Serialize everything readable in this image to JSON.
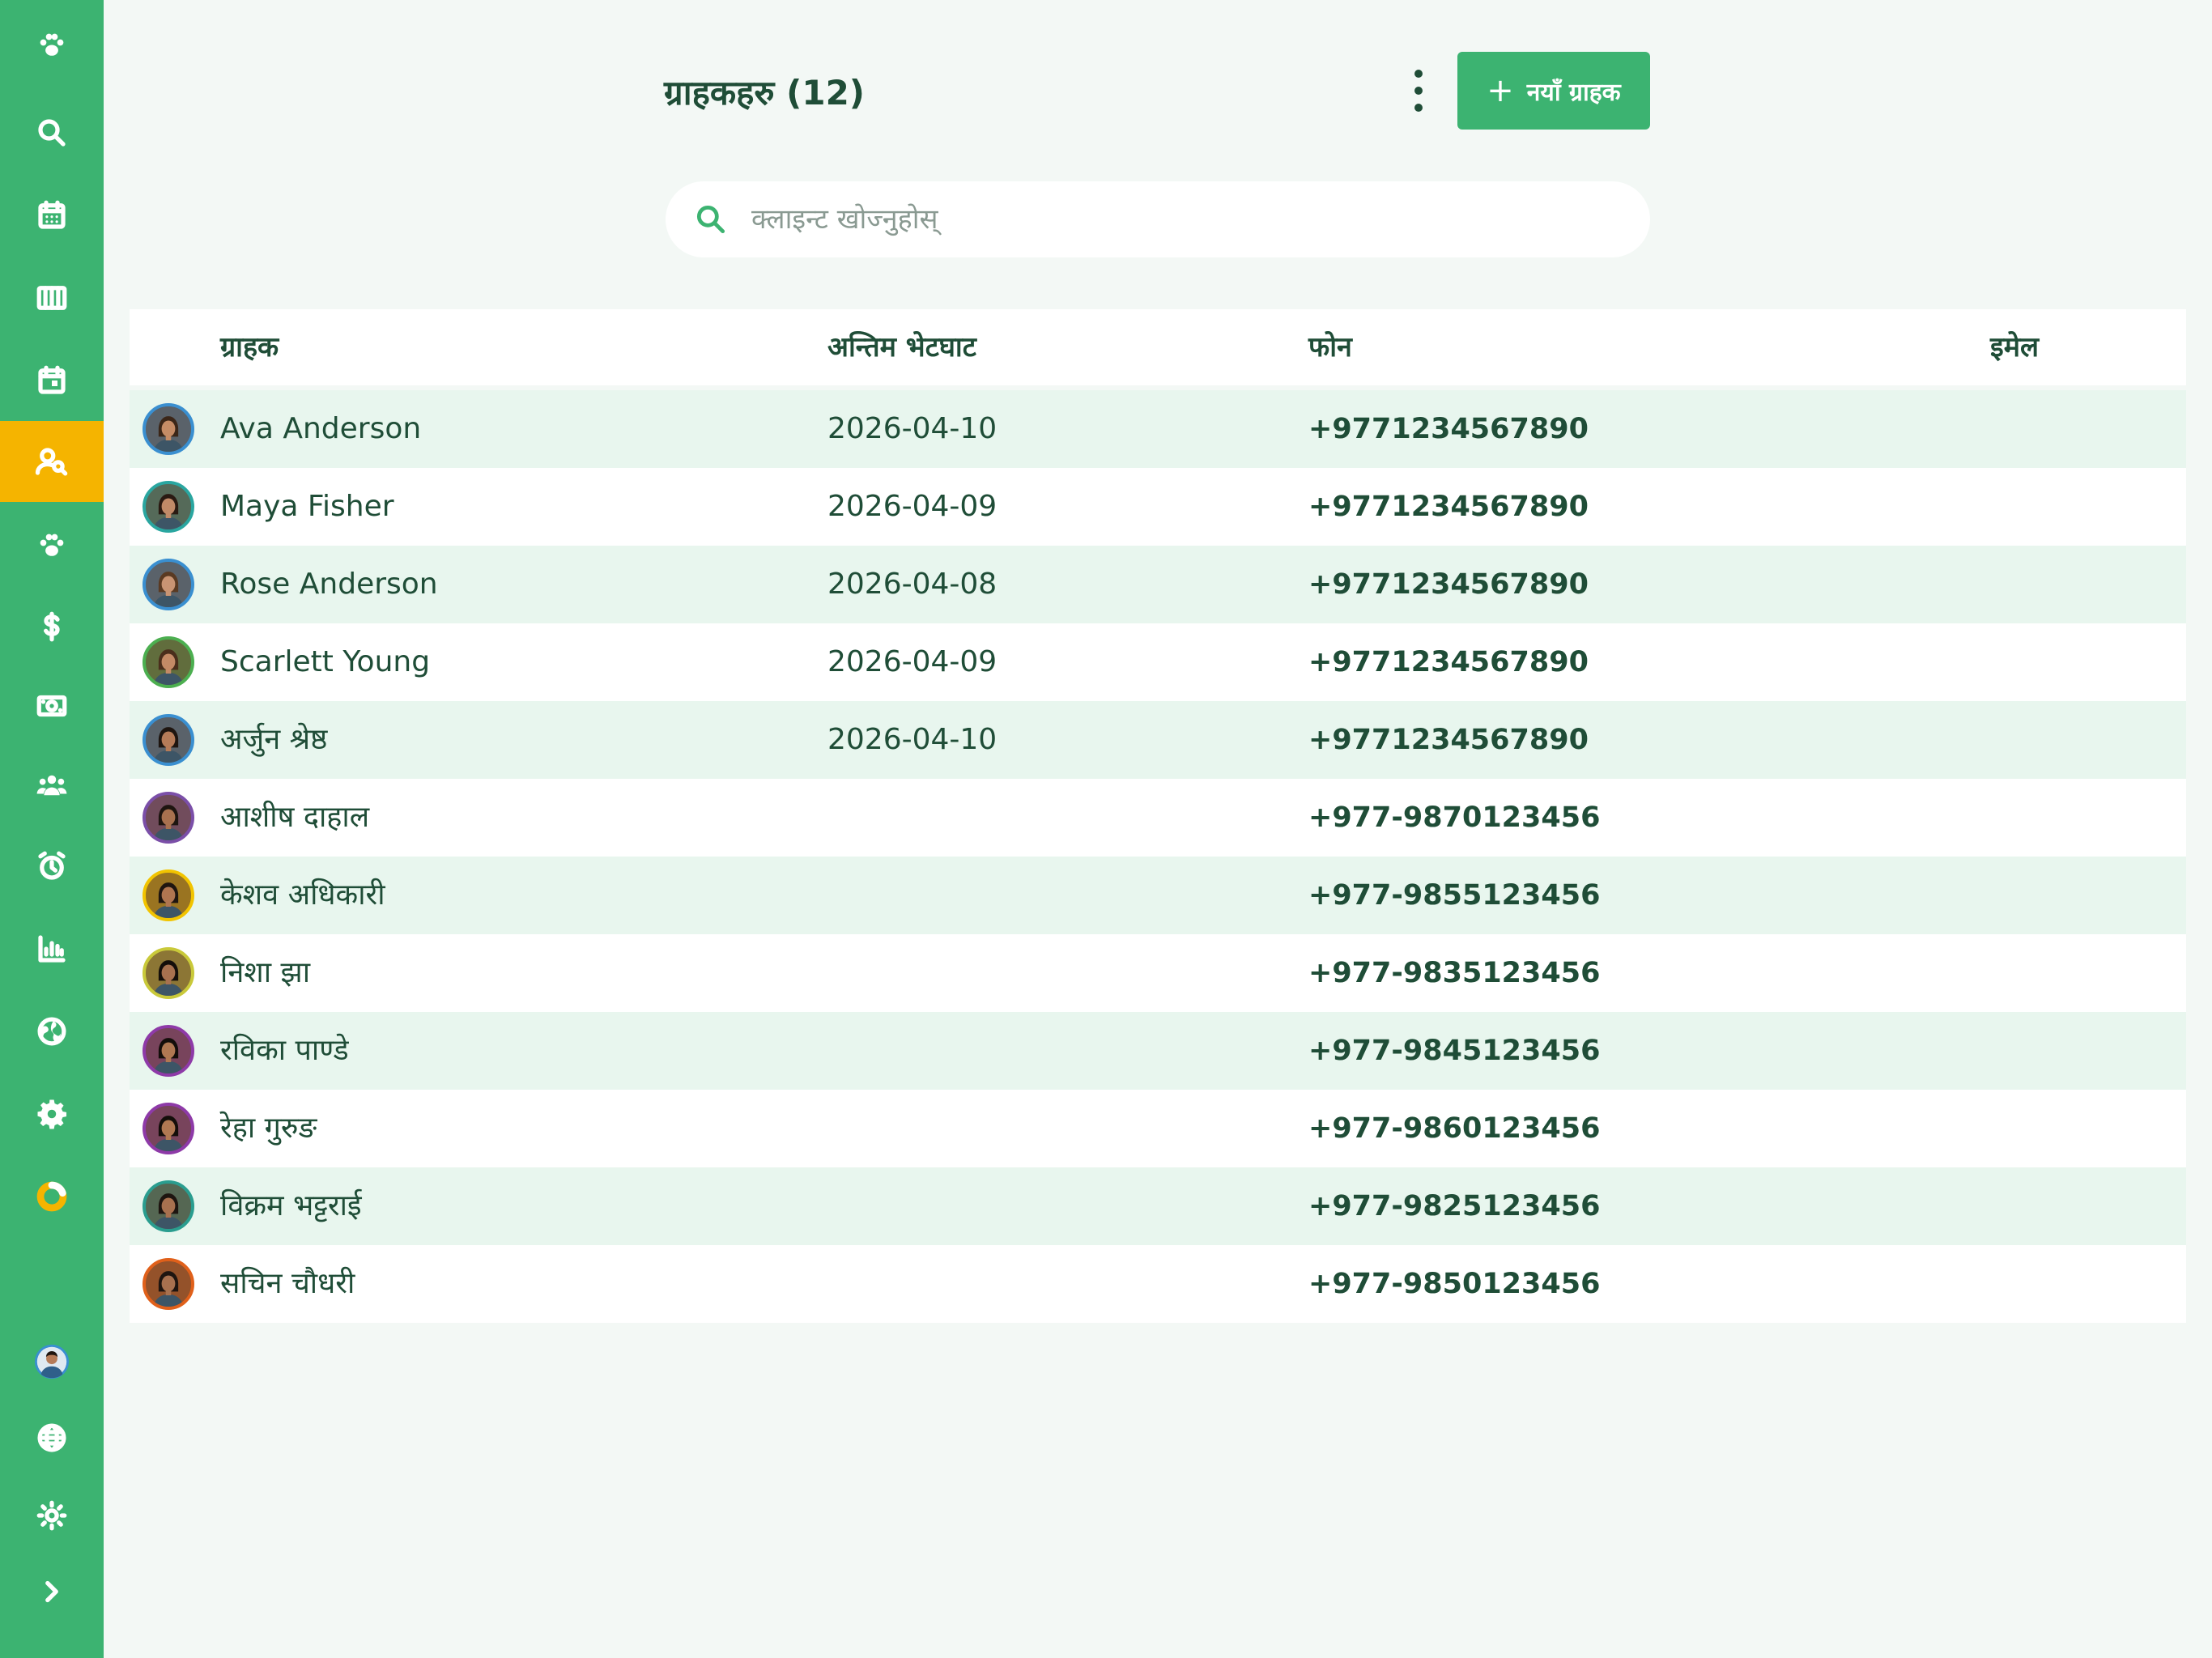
{
  "sidebar": {
    "items": [
      {
        "icon": "paw-icon",
        "active": false
      },
      {
        "icon": "search-icon",
        "active": false
      },
      {
        "icon": "calendar-grid-icon",
        "active": false
      },
      {
        "icon": "columns-icon",
        "active": false
      },
      {
        "icon": "calendar-event-icon",
        "active": false
      },
      {
        "icon": "client-search-icon",
        "active": true
      },
      {
        "icon": "paw-icon",
        "active": false
      },
      {
        "icon": "dollar-icon",
        "active": false
      },
      {
        "icon": "cash-icon",
        "active": false
      },
      {
        "icon": "group-icon",
        "active": false
      },
      {
        "icon": "alarm-clock-icon",
        "active": false
      },
      {
        "icon": "bar-chart-icon",
        "active": false
      },
      {
        "icon": "globe-icon",
        "active": false
      },
      {
        "icon": "gear-icon",
        "active": false
      },
      {
        "icon": "donut-icon",
        "active": false
      }
    ],
    "bottom": [
      {
        "icon": "user-avatar-icon"
      },
      {
        "icon": "language-globe-icon"
      },
      {
        "icon": "brightness-icon"
      },
      {
        "icon": "chevron-right-icon"
      }
    ],
    "accent": "#3cb371",
    "active_color": "#f5b400"
  },
  "header": {
    "title": "ग्राहकहरु (12)",
    "new_button_label": "नयाँ ग्राहक",
    "new_button_icon": "plus-icon",
    "more_icon": "kebab-menu-icon"
  },
  "search": {
    "placeholder": "क्लाइन्ट खोज्नुहोस्",
    "value": "",
    "icon": "search-icon"
  },
  "table": {
    "columns": {
      "client": "ग्राहक",
      "last_visit": "अन्तिम भेटघाट",
      "phone": "फोन",
      "email": "इमेल"
    },
    "rows": [
      {
        "name": "Ava Anderson",
        "last_visit": "2026-04-10",
        "phone": "+9771234567890",
        "email": "",
        "ring": "#3a8fd0",
        "skin": "#c58c66",
        "hair": "#3b2618"
      },
      {
        "name": "Maya Fisher",
        "last_visit": "2026-04-09",
        "phone": "+9771234567890",
        "email": "",
        "ring": "#2aa6a0",
        "skin": "#c08a68",
        "hair": "#2a1a12"
      },
      {
        "name": "Rose Anderson",
        "last_visit": "2026-04-08",
        "phone": "+9771234567890",
        "email": "",
        "ring": "#3a8fd0",
        "skin": "#c99473",
        "hair": "#5a3a22"
      },
      {
        "name": "Scarlett Young",
        "last_visit": "2026-04-09",
        "phone": "+9771234567890",
        "email": "",
        "ring": "#4caf50",
        "skin": "#c48a66",
        "hair": "#4a2e1c"
      },
      {
        "name": "अर्जुन श्रेष्ठ",
        "last_visit": "2026-04-10",
        "phone": "+9771234567890",
        "email": "",
        "ring": "#3a8fd0",
        "skin": "#b57b58",
        "hair": "#1e1510"
      },
      {
        "name": "आशीष दाहाल",
        "last_visit": "",
        "phone": "+977-9870123456",
        "email": "",
        "ring": "#7b4fa8",
        "skin": "#a8714f",
        "hair": "#1e1510"
      },
      {
        "name": "केशव अधिकारी",
        "last_visit": "",
        "phone": "+977-9855123456",
        "email": "",
        "ring": "#f2c400",
        "skin": "#b07550",
        "hair": "#1e1510"
      },
      {
        "name": "निशा झा",
        "last_visit": "",
        "phone": "+977-9835123456",
        "email": "",
        "ring": "#c9c93a",
        "skin": "#a8714f",
        "hair": "#140e0a"
      },
      {
        "name": "रविका पाण्डे",
        "last_visit": "",
        "phone": "+977-9845123456",
        "email": "",
        "ring": "#8e3aa8",
        "skin": "#b07852",
        "hair": "#140e0a"
      },
      {
        "name": "रेहा गुरुङ",
        "last_visit": "",
        "phone": "+977-9860123456",
        "email": "",
        "ring": "#8e3aa8",
        "skin": "#b07852",
        "hair": "#140e0a"
      },
      {
        "name": "विक्रम भट्टराई",
        "last_visit": "",
        "phone": "+977-9825123456",
        "email": "",
        "ring": "#2a9d8f",
        "skin": "#a8714f",
        "hair": "#1e1510"
      },
      {
        "name": "सचिन चौधरी",
        "last_visit": "",
        "phone": "+977-9850123456",
        "email": "",
        "ring": "#e0601a",
        "skin": "#a8714f",
        "hair": "#1e1510"
      }
    ]
  }
}
